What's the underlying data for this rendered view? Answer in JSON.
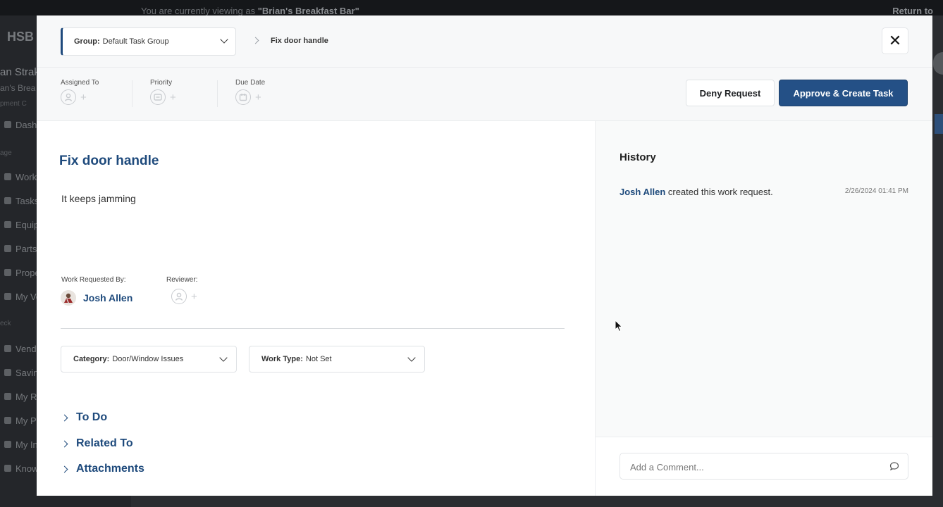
{
  "background": {
    "banner_text": "You are currently viewing as ",
    "banner_name": "\"Brian's Breakfast Bar\"",
    "return_label": "Return to",
    "logo": "HSB",
    "user_name": "an Strak",
    "user_org": "an's Brea",
    "nav_items": [
      "Dashb",
      "Work",
      "Tasks",
      "Equip",
      "Parts",
      "Prope",
      "My Ve",
      "Vendo",
      "Savin",
      "My RH",
      "My Pr",
      "My In",
      "Know"
    ],
    "sections": [
      "pment C",
      "age",
      "eck"
    ]
  },
  "modal": {
    "group_label": "Group:",
    "group_value": "Default Task Group",
    "breadcrumb_current": "Fix door handle",
    "close_label": "✕"
  },
  "meta": {
    "assigned_to_label": "Assigned To",
    "priority_label": "Priority",
    "due_date_label": "Due Date",
    "plus": "+"
  },
  "actions": {
    "deny_label": "Deny Request",
    "approve_label": "Approve & Create Task"
  },
  "request": {
    "title": "Fix door handle",
    "description": "It keeps jamming",
    "requested_by_label": "Work Requested By:",
    "requested_by_name": "Josh Allen",
    "reviewer_label": "Reviewer:",
    "category_label": "Category:",
    "category_value": "Door/Window Issues",
    "work_type_label": "Work Type:",
    "work_type_value": "Not Set",
    "sections": [
      "To Do",
      "Related To",
      "Attachments"
    ]
  },
  "history": {
    "title": "History",
    "entries": [
      {
        "actor": "Josh Allen",
        "action": " created this work request.",
        "time": "2/26/2024 01:41 PM"
      }
    ],
    "comment_placeholder": "Add a Comment..."
  },
  "colors": {
    "accent": "#1e4a7c",
    "approve_button": "#245086"
  }
}
